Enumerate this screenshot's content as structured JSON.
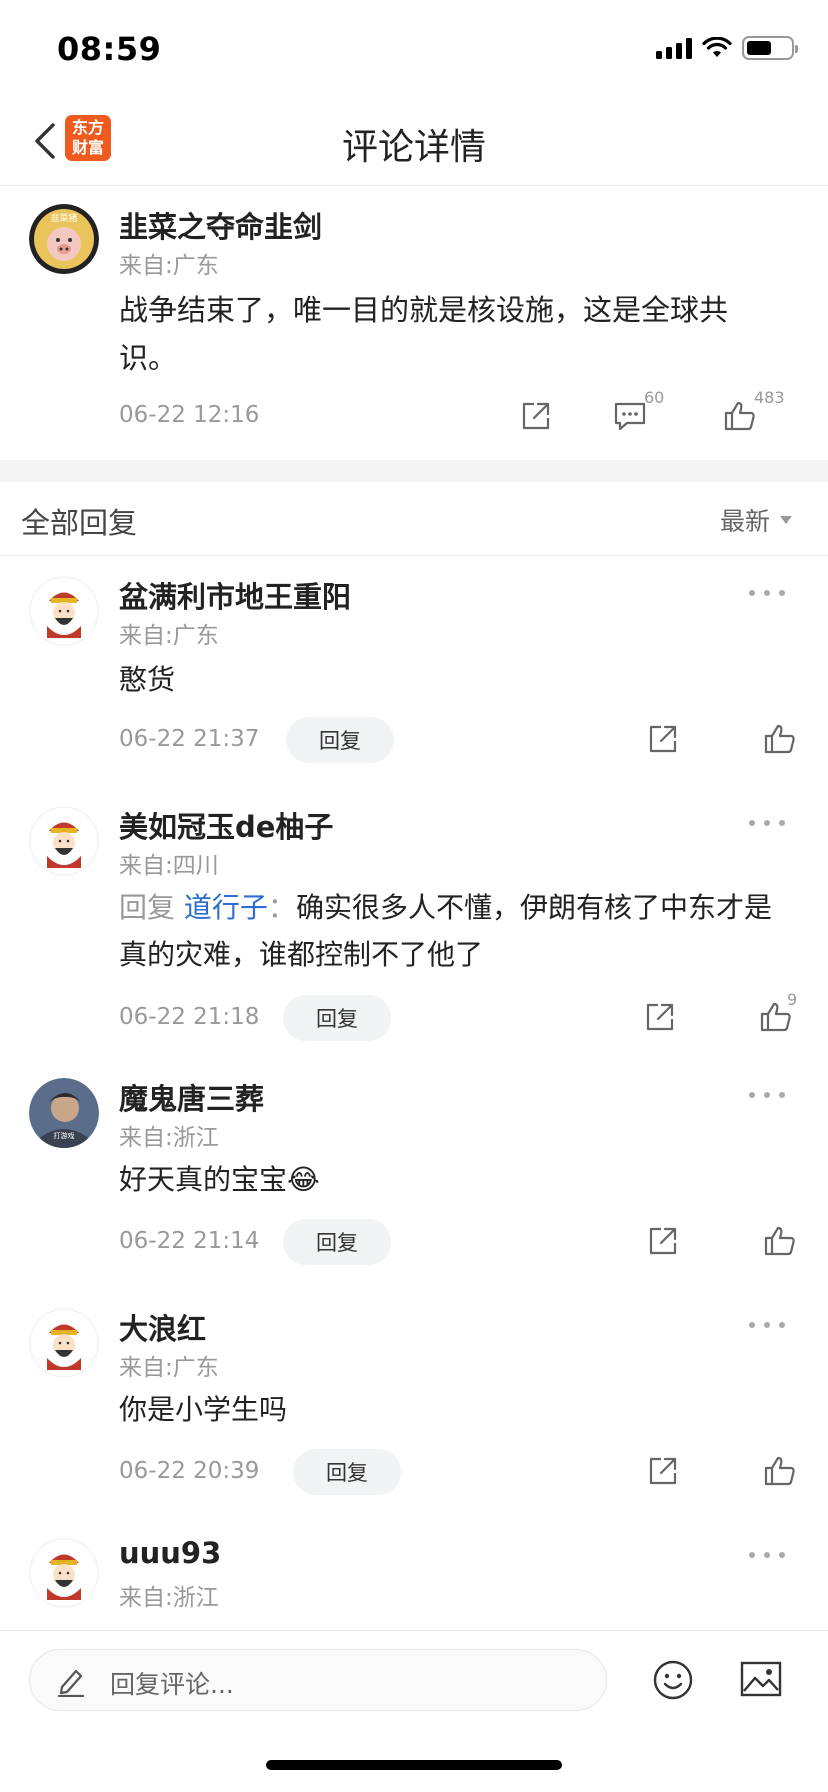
{
  "status": {
    "time": "08:59"
  },
  "nav": {
    "title": "评论详情",
    "logo_line1": "东方",
    "logo_line2": "财富"
  },
  "post": {
    "author": "韭菜之夺命韭剑",
    "location": "来自:广东",
    "text": "战争结束了，唯一目的就是核设施，这是全球共识。",
    "time": "06-22 12:16",
    "comment_count": "60",
    "like_count": "483",
    "avatar_text": "韭菜猪"
  },
  "replies_header": {
    "title": "全部回复",
    "sort": "最新"
  },
  "replies": [
    {
      "author": "盆满利市地王重阳",
      "location": "来自:广东",
      "text": "憨货",
      "time": "06-22 21:37",
      "reply_label": "回复",
      "like_count": ""
    },
    {
      "author": "美如冠玉de柚子",
      "location": "来自:四川",
      "reply_to_prefix": "回复 ",
      "reply_to_user": "道行子",
      "reply_to_sep": "：",
      "text": "确实很多人不懂，伊朗有核了中东才是真的灾难，谁都控制不了他了",
      "time": "06-22 21:18",
      "reply_label": "回复",
      "like_count": "9"
    },
    {
      "author": "魔鬼唐三葬",
      "location": "来自:浙江",
      "text": "好天真的宝宝",
      "emoji": "😂",
      "time": "06-22 21:14",
      "reply_label": "回复",
      "like_count": "",
      "avatar_text": "打游戏"
    },
    {
      "author": "大浪红",
      "location": "来自:广东",
      "text": "你是小学生吗",
      "time": "06-22 20:39",
      "reply_label": "回复",
      "like_count": ""
    },
    {
      "author": "uuu93",
      "location": "来自:浙江"
    }
  ],
  "input": {
    "placeholder": "回复评论..."
  },
  "colors": {
    "brand": "#f05a1e",
    "link": "#2f6ed1",
    "muted": "#999999"
  }
}
